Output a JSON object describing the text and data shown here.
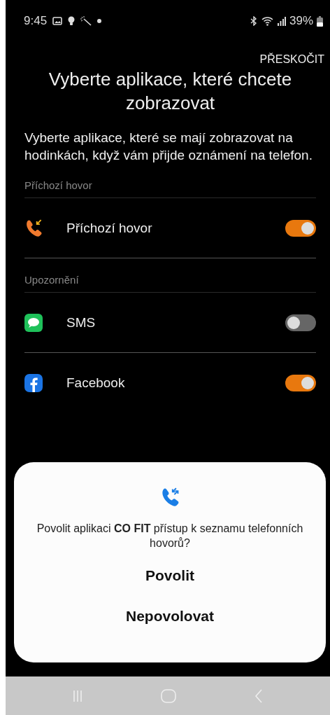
{
  "status_bar": {
    "time": "9:45",
    "battery": "39%"
  },
  "skip_button": "PŘESKOČIT",
  "title": "Vyberte aplikace, které chcete zobrazovat",
  "description": "Vyberte aplikace, které se mají zobrazovat na hodinkách, když vám přijde oznámení na telefon.",
  "sections": [
    {
      "header": "Příchozí hovor",
      "items": [
        {
          "kind": "call",
          "label": "Příchozí hovor",
          "on": true
        }
      ]
    },
    {
      "header": "Upozornění",
      "items": [
        {
          "kind": "sms",
          "label": "SMS",
          "on": false
        },
        {
          "kind": "facebook",
          "label": "Facebook",
          "on": true
        }
      ]
    }
  ],
  "dialog": {
    "message": "Povolit aplikaci **CO FIT** přístup k seznamu telefonních hovorů?",
    "buttons": [
      "Povolit",
      "Nepovolovat"
    ]
  }
}
